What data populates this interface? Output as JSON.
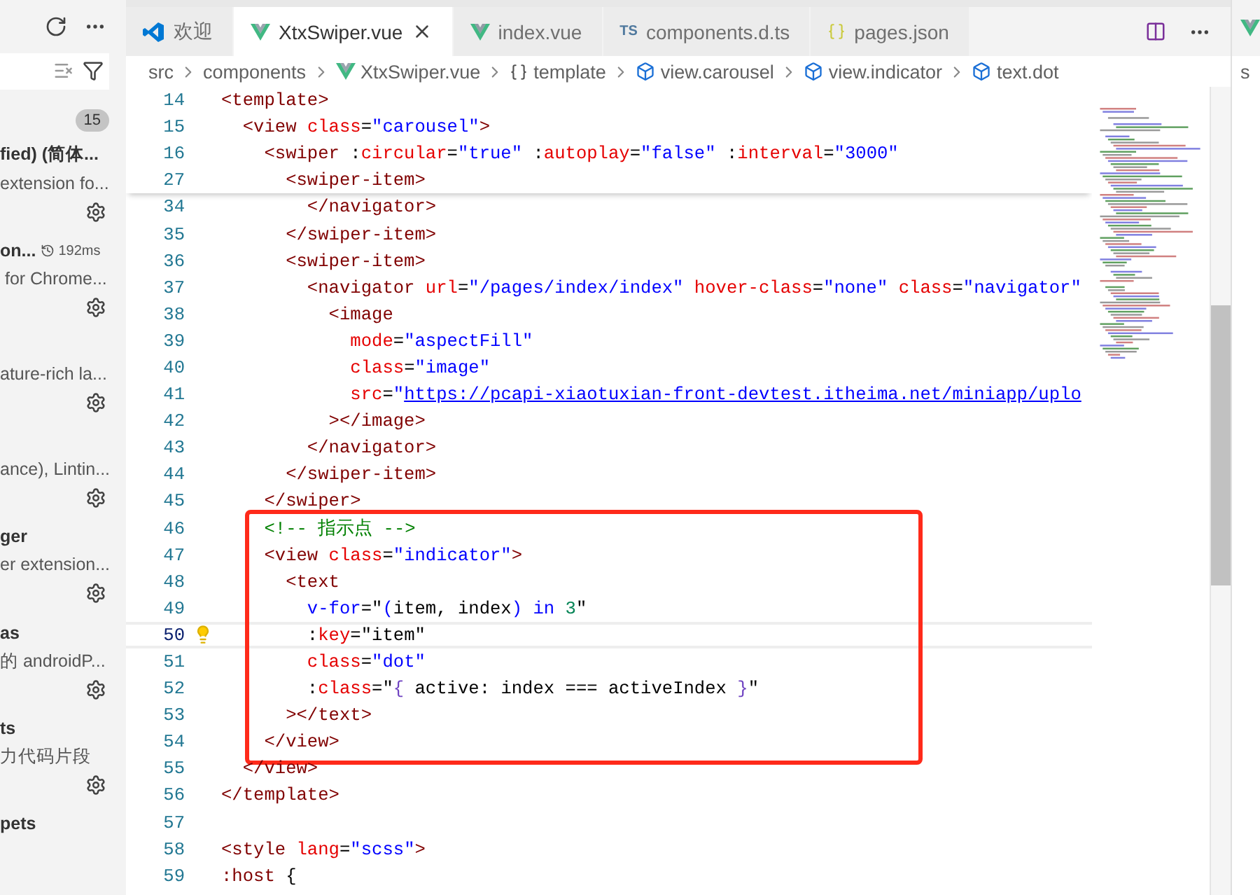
{
  "sidebar": {
    "badge": "15",
    "items": [
      {
        "title": "fied) (简体...",
        "description": "extension fo..."
      },
      {
        "title": "on...",
        "timing": "192ms",
        "description": " for Chrome..."
      },
      {
        "description": "ature-rich la..."
      },
      {
        "description": "ance), Lintin..."
      },
      {
        "title": "ger",
        "description": "er extension..."
      },
      {
        "title": "as",
        "description": "的 androidP..."
      },
      {
        "title": "ts",
        "description": "力代码片段"
      },
      {
        "title": "pets"
      }
    ]
  },
  "tabs": [
    {
      "label": "欢迎",
      "kind": "vscode",
      "selected": false
    },
    {
      "label": "XtxSwiper.vue",
      "kind": "vue",
      "selected": true
    },
    {
      "label": "index.vue",
      "kind": "vue",
      "selected": false
    },
    {
      "label": "components.d.ts",
      "kind": "ts",
      "icon_label": "TS",
      "selected": false
    },
    {
      "label": "pages.json",
      "kind": "json",
      "selected": false
    }
  ],
  "breadcrumbs": [
    {
      "label": "src",
      "kind": "folder"
    },
    {
      "label": "components",
      "kind": "folder"
    },
    {
      "label": "XtxSwiper.vue",
      "kind": "vue"
    },
    {
      "label": "template",
      "kind": "braces"
    },
    {
      "label": "view.carousel",
      "kind": "element"
    },
    {
      "label": "view.indicator",
      "kind": "element"
    },
    {
      "label": "text.dot",
      "kind": "element"
    }
  ],
  "side_panel": {
    "breadcrumb": "s"
  },
  "sticky_lines": [
    {
      "number": "14",
      "current": false,
      "tokens": [
        {
          "kind": "tag",
          "text": "<template>"
        }
      ]
    },
    {
      "number": "15",
      "current": false,
      "tokens": [
        {
          "kind": "tag",
          "text": "  <view"
        },
        {
          "kind": "attr",
          "text": " class"
        },
        {
          "kind": "plain",
          "text": "="
        },
        {
          "kind": "str",
          "text": "\"carousel\""
        },
        {
          "kind": "tag",
          "text": ">"
        }
      ]
    },
    {
      "number": "16",
      "current": false,
      "tokens": [
        {
          "kind": "tag",
          "text": "    <swiper"
        },
        {
          "kind": "plain",
          "text": " :"
        },
        {
          "kind": "attr",
          "text": "circular"
        },
        {
          "kind": "plain",
          "text": "="
        },
        {
          "kind": "str",
          "text": "\"true\""
        },
        {
          "kind": "plain",
          "text": " :"
        },
        {
          "kind": "attr",
          "text": "autoplay"
        },
        {
          "kind": "plain",
          "text": "="
        },
        {
          "kind": "str",
          "text": "\"false\""
        },
        {
          "kind": "plain",
          "text": " :"
        },
        {
          "kind": "attr",
          "text": "interval"
        },
        {
          "kind": "plain",
          "text": "="
        },
        {
          "kind": "str",
          "text": "\"3000\""
        }
      ]
    },
    {
      "number": "27",
      "current": false,
      "tokens": [
        {
          "kind": "tag",
          "text": "      <swiper-item>"
        }
      ]
    }
  ],
  "code_blocks": [
    {
      "annotated": false,
      "lines": [
        {
          "number": "34",
          "current": false,
          "tokens": [
            {
              "kind": "tag",
              "text": "        </navigator>"
            }
          ]
        },
        {
          "number": "35",
          "current": false,
          "tokens": [
            {
              "kind": "tag",
              "text": "      </swiper-item>"
            }
          ]
        },
        {
          "number": "36",
          "current": false,
          "tokens": [
            {
              "kind": "tag",
              "text": "      <swiper-item>"
            }
          ]
        },
        {
          "number": "37",
          "current": false,
          "tokens": [
            {
              "kind": "tag",
              "text": "        <navigator"
            },
            {
              "kind": "attr",
              "text": " url"
            },
            {
              "kind": "plain",
              "text": "="
            },
            {
              "kind": "str",
              "text": "\"/pages/index/index\""
            },
            {
              "kind": "attr",
              "text": " hover-class"
            },
            {
              "kind": "plain",
              "text": "="
            },
            {
              "kind": "str",
              "text": "\"none\""
            },
            {
              "kind": "attr",
              "text": " class"
            },
            {
              "kind": "plain",
              "text": "="
            },
            {
              "kind": "str",
              "text": "\"navigator\""
            }
          ]
        },
        {
          "number": "38",
          "current": false,
          "tokens": [
            {
              "kind": "tag",
              "text": "          <image"
            }
          ]
        },
        {
          "number": "39",
          "current": false,
          "tokens": [
            {
              "kind": "attr",
              "text": "            mode"
            },
            {
              "kind": "plain",
              "text": "="
            },
            {
              "kind": "str",
              "text": "\"aspectFill\""
            }
          ]
        },
        {
          "number": "40",
          "current": false,
          "tokens": [
            {
              "kind": "attr",
              "text": "            class"
            },
            {
              "kind": "plain",
              "text": "="
            },
            {
              "kind": "str",
              "text": "\"image\""
            }
          ]
        },
        {
          "number": "41",
          "current": false,
          "tokens": [
            {
              "kind": "attr",
              "text": "            src"
            },
            {
              "kind": "plain",
              "text": "="
            },
            {
              "kind": "str",
              "text": "\""
            },
            {
              "kind": "link",
              "text": "https://pcapi-xiaotuxian-front-devtest.itheima.net/miniapp/uplo"
            }
          ]
        },
        {
          "number": "42",
          "current": false,
          "tokens": [
            {
              "kind": "tag",
              "text": "          ></image>"
            }
          ]
        },
        {
          "number": "43",
          "current": false,
          "tokens": [
            {
              "kind": "tag",
              "text": "        </navigator>"
            }
          ]
        },
        {
          "number": "44",
          "current": false,
          "tokens": [
            {
              "kind": "tag",
              "text": "      </swiper-item>"
            }
          ]
        },
        {
          "number": "45",
          "current": false,
          "tokens": [
            {
              "kind": "tag",
              "text": "    </swiper>"
            }
          ]
        }
      ]
    },
    {
      "annotated": true,
      "lines": [
        {
          "number": "46",
          "current": false,
          "tokens": [
            {
              "kind": "comment",
              "text": "    <!-- 指示点 -->"
            }
          ]
        },
        {
          "number": "47",
          "current": false,
          "tokens": [
            {
              "kind": "tag",
              "text": "    <view"
            },
            {
              "kind": "attr",
              "text": " class"
            },
            {
              "kind": "plain",
              "text": "="
            },
            {
              "kind": "str",
              "text": "\"indicator\""
            },
            {
              "kind": "tag",
              "text": ">"
            }
          ]
        },
        {
          "number": "48",
          "current": false,
          "tokens": [
            {
              "kind": "tag",
              "text": "      <text"
            }
          ]
        },
        {
          "number": "49",
          "current": false,
          "tokens": [
            {
              "kind": "dir",
              "text": "        v-for"
            },
            {
              "kind": "plain",
              "text": "=\""
            },
            {
              "kind": "dir",
              "text": "("
            },
            {
              "kind": "plain",
              "text": "item, index"
            },
            {
              "kind": "dir",
              "text": ") in "
            },
            {
              "kind": "num",
              "text": "3"
            },
            {
              "kind": "plain",
              "text": "\""
            }
          ]
        },
        {
          "number": "50",
          "current": true,
          "tokens": [
            {
              "kind": "plain",
              "text": "        :"
            },
            {
              "kind": "attr",
              "text": "key"
            },
            {
              "kind": "plain",
              "text": "=\"item\""
            }
          ]
        },
        {
          "number": "51",
          "current": false,
          "tokens": [
            {
              "kind": "attr",
              "text": "        class"
            },
            {
              "kind": "plain",
              "text": "="
            },
            {
              "kind": "str",
              "text": "\"dot\""
            }
          ]
        },
        {
          "number": "52",
          "current": false,
          "tokens": [
            {
              "kind": "plain",
              "text": "        :"
            },
            {
              "kind": "attr",
              "text": "class"
            },
            {
              "kind": "plain",
              "text": "=\""
            },
            {
              "kind": "brace",
              "text": "{"
            },
            {
              "kind": "plain",
              "text": " active: index === activeIndex "
            },
            {
              "kind": "brace",
              "text": "}"
            },
            {
              "kind": "plain",
              "text": "\""
            }
          ]
        },
        {
          "number": "53",
          "current": false,
          "tokens": [
            {
              "kind": "tag",
              "text": "      ></text>"
            }
          ]
        },
        {
          "number": "54",
          "current": false,
          "tokens": [
            {
              "kind": "tag",
              "text": "    </view>"
            }
          ]
        }
      ]
    },
    {
      "annotated": false,
      "lines": [
        {
          "number": "55",
          "current": false,
          "tokens": [
            {
              "kind": "tag",
              "text": "  </view>"
            }
          ]
        },
        {
          "number": "56",
          "current": false,
          "tokens": [
            {
              "kind": "tag",
              "text": "</template>"
            }
          ]
        },
        {
          "number": "57",
          "current": false
        },
        {
          "number": "58",
          "current": false,
          "tokens": [
            {
              "kind": "tag",
              "text": "<style"
            },
            {
              "kind": "attr",
              "text": " lang"
            },
            {
              "kind": "plain",
              "text": "="
            },
            {
              "kind": "str",
              "text": "\"scss\""
            },
            {
              "kind": "tag",
              "text": ">"
            }
          ]
        },
        {
          "number": "59",
          "current": false,
          "tokens": [
            {
              "kind": "tag",
              "text": ":host"
            },
            {
              "kind": "plain",
              "text": " {"
            }
          ]
        }
      ]
    }
  ]
}
